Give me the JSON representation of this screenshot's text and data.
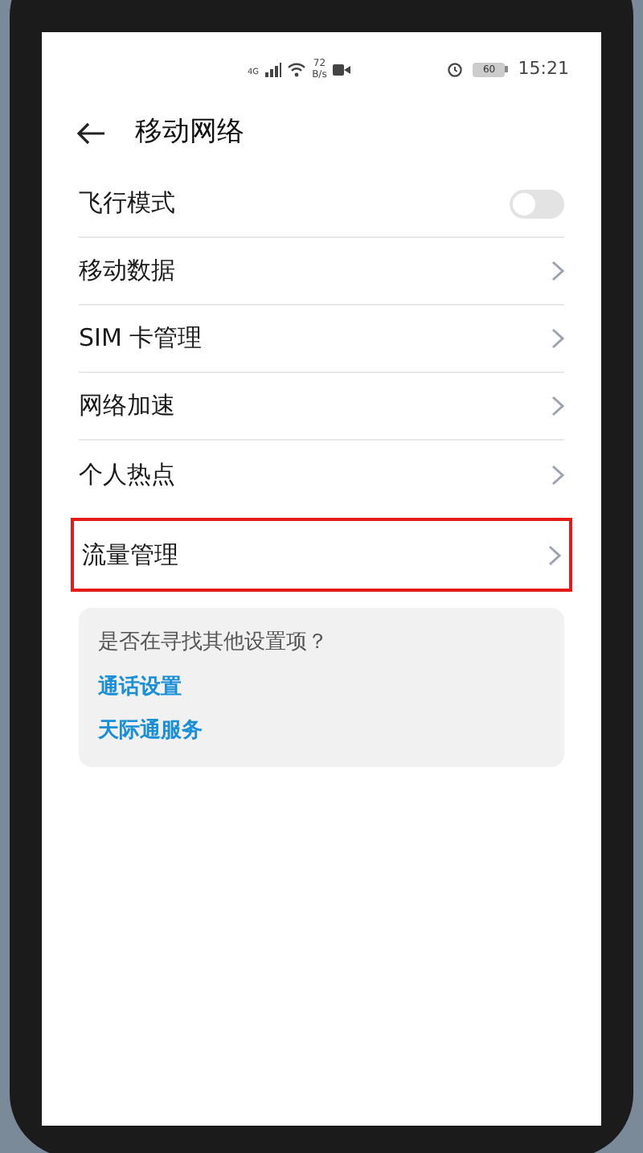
{
  "status_bar": {
    "network": "4G",
    "speed_value": "72",
    "speed_unit": "B/s",
    "battery": "60",
    "time": "15:21"
  },
  "header": {
    "title": "移动网络"
  },
  "settings": [
    {
      "kind": "toggle",
      "label": "飞行模式",
      "on": false,
      "highlighted": false
    },
    {
      "kind": "link",
      "label": "移动数据",
      "highlighted": false
    },
    {
      "kind": "link",
      "label": "SIM 卡管理",
      "highlighted": false
    },
    {
      "kind": "link",
      "label": "网络加速",
      "highlighted": false
    },
    {
      "kind": "link",
      "label": "个人热点",
      "highlighted": false
    },
    {
      "kind": "link",
      "label": "流量管理",
      "highlighted": true
    }
  ],
  "suggestions": {
    "question": "是否在寻找其他设置项？",
    "links": [
      "通话设置",
      "天际通服务"
    ]
  }
}
